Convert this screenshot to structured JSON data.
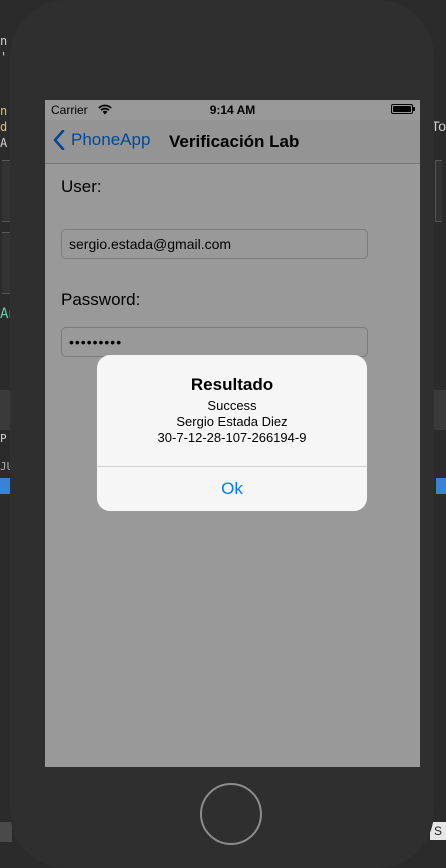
{
  "background": {
    "fragments": [
      "n",
      "' A",
      "n",
      "d",
      "A",
      "An",
      "To",
      "P",
      "JU",
      "/J",
      "S"
    ]
  },
  "status_bar": {
    "carrier": "Carrier",
    "time": "9:14 AM"
  },
  "nav": {
    "back_label": "PhoneApp",
    "title": "Verificación Lab"
  },
  "form": {
    "user_label": "User:",
    "user_value": "sergio.estada@gmail.com",
    "password_label": "Password:",
    "password_value": "•••••••••"
  },
  "alert": {
    "title": "Resultado",
    "line1": "Success",
    "line2": "Sergio Estada Diez",
    "line3": "30-7-12-28-107-266194-9",
    "ok_label": "Ok"
  },
  "colors": {
    "accent": "#007aff",
    "device": "#2f2f2f",
    "ide_background": "#2b2b2b"
  }
}
